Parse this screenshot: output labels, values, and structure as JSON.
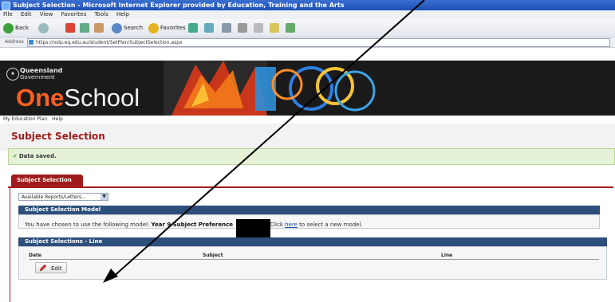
{
  "window": {
    "title": "Subject Selection - Microsoft Internet Explorer provided by Education, Training and the Arts",
    "menu": [
      "File",
      "Edit",
      "View",
      "Favorites",
      "Tools",
      "Help"
    ],
    "toolbar": {
      "back_label": "Back",
      "search_label": "Search",
      "favorites_label": "Favorites"
    },
    "address": {
      "label": "Address",
      "url": "https://oslp.eq.edu.au/student/SetPlan/SubjectSelection.aspx"
    }
  },
  "banner": {
    "gov_line1": "Queensland",
    "gov_line2": "Government",
    "brand_one": "One",
    "brand_school": "School"
  },
  "nav": {
    "items": [
      "My Education Plan",
      "Help"
    ]
  },
  "page": {
    "title": "Subject Selection",
    "saved_message": "Data saved.",
    "tab_label": "Subject Selection",
    "reports_select": "Available Reports/Letters..."
  },
  "model_panel": {
    "header": "Subject Selection Model",
    "text_prefix": "You have chosen to use the following model:",
    "model_name": "Year 9 Subject Preference",
    "text_mid": "Click",
    "link": "here",
    "text_suffix": "to select a new model."
  },
  "selections_panel": {
    "header": "Subject Selections - Line",
    "columns": [
      "Date",
      "Subject",
      "Line"
    ],
    "edit_label": "Edit"
  },
  "colors": {
    "accent": "#a01b1b",
    "panel_header": "#2d4f7c",
    "brand_orange": "#ff5f1f"
  },
  "icons": [
    "ie-icon",
    "back-icon",
    "forward-icon",
    "stop-icon",
    "refresh-icon",
    "home-icon",
    "search-icon",
    "favorites-icon",
    "check-icon",
    "pencil-icon",
    "chevron-down-icon"
  ]
}
